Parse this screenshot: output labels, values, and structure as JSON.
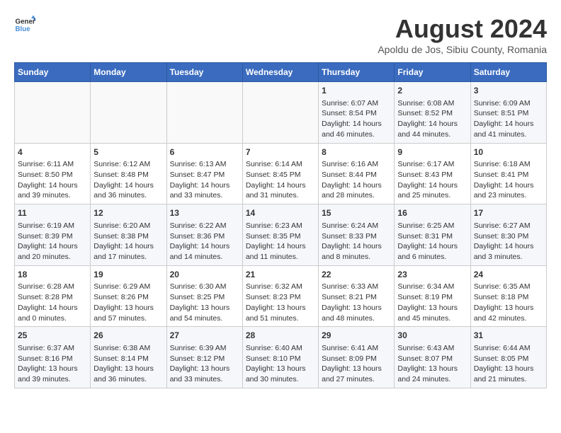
{
  "logo": {
    "line1": "General",
    "line2": "Blue"
  },
  "title": "August 2024",
  "subtitle": "Apoldu de Jos, Sibiu County, Romania",
  "weekdays": [
    "Sunday",
    "Monday",
    "Tuesday",
    "Wednesday",
    "Thursday",
    "Friday",
    "Saturday"
  ],
  "weeks": [
    [
      {
        "day": "",
        "info": ""
      },
      {
        "day": "",
        "info": ""
      },
      {
        "day": "",
        "info": ""
      },
      {
        "day": "",
        "info": ""
      },
      {
        "day": "1",
        "info": "Sunrise: 6:07 AM\nSunset: 8:54 PM\nDaylight: 14 hours and 46 minutes."
      },
      {
        "day": "2",
        "info": "Sunrise: 6:08 AM\nSunset: 8:52 PM\nDaylight: 14 hours and 44 minutes."
      },
      {
        "day": "3",
        "info": "Sunrise: 6:09 AM\nSunset: 8:51 PM\nDaylight: 14 hours and 41 minutes."
      }
    ],
    [
      {
        "day": "4",
        "info": "Sunrise: 6:11 AM\nSunset: 8:50 PM\nDaylight: 14 hours and 39 minutes."
      },
      {
        "day": "5",
        "info": "Sunrise: 6:12 AM\nSunset: 8:48 PM\nDaylight: 14 hours and 36 minutes."
      },
      {
        "day": "6",
        "info": "Sunrise: 6:13 AM\nSunset: 8:47 PM\nDaylight: 14 hours and 33 minutes."
      },
      {
        "day": "7",
        "info": "Sunrise: 6:14 AM\nSunset: 8:45 PM\nDaylight: 14 hours and 31 minutes."
      },
      {
        "day": "8",
        "info": "Sunrise: 6:16 AM\nSunset: 8:44 PM\nDaylight: 14 hours and 28 minutes."
      },
      {
        "day": "9",
        "info": "Sunrise: 6:17 AM\nSunset: 8:43 PM\nDaylight: 14 hours and 25 minutes."
      },
      {
        "day": "10",
        "info": "Sunrise: 6:18 AM\nSunset: 8:41 PM\nDaylight: 14 hours and 23 minutes."
      }
    ],
    [
      {
        "day": "11",
        "info": "Sunrise: 6:19 AM\nSunset: 8:39 PM\nDaylight: 14 hours and 20 minutes."
      },
      {
        "day": "12",
        "info": "Sunrise: 6:20 AM\nSunset: 8:38 PM\nDaylight: 14 hours and 17 minutes."
      },
      {
        "day": "13",
        "info": "Sunrise: 6:22 AM\nSunset: 8:36 PM\nDaylight: 14 hours and 14 minutes."
      },
      {
        "day": "14",
        "info": "Sunrise: 6:23 AM\nSunset: 8:35 PM\nDaylight: 14 hours and 11 minutes."
      },
      {
        "day": "15",
        "info": "Sunrise: 6:24 AM\nSunset: 8:33 PM\nDaylight: 14 hours and 8 minutes."
      },
      {
        "day": "16",
        "info": "Sunrise: 6:25 AM\nSunset: 8:31 PM\nDaylight: 14 hours and 6 minutes."
      },
      {
        "day": "17",
        "info": "Sunrise: 6:27 AM\nSunset: 8:30 PM\nDaylight: 14 hours and 3 minutes."
      }
    ],
    [
      {
        "day": "18",
        "info": "Sunrise: 6:28 AM\nSunset: 8:28 PM\nDaylight: 14 hours and 0 minutes."
      },
      {
        "day": "19",
        "info": "Sunrise: 6:29 AM\nSunset: 8:26 PM\nDaylight: 13 hours and 57 minutes."
      },
      {
        "day": "20",
        "info": "Sunrise: 6:30 AM\nSunset: 8:25 PM\nDaylight: 13 hours and 54 minutes."
      },
      {
        "day": "21",
        "info": "Sunrise: 6:32 AM\nSunset: 8:23 PM\nDaylight: 13 hours and 51 minutes."
      },
      {
        "day": "22",
        "info": "Sunrise: 6:33 AM\nSunset: 8:21 PM\nDaylight: 13 hours and 48 minutes."
      },
      {
        "day": "23",
        "info": "Sunrise: 6:34 AM\nSunset: 8:19 PM\nDaylight: 13 hours and 45 minutes."
      },
      {
        "day": "24",
        "info": "Sunrise: 6:35 AM\nSunset: 8:18 PM\nDaylight: 13 hours and 42 minutes."
      }
    ],
    [
      {
        "day": "25",
        "info": "Sunrise: 6:37 AM\nSunset: 8:16 PM\nDaylight: 13 hours and 39 minutes."
      },
      {
        "day": "26",
        "info": "Sunrise: 6:38 AM\nSunset: 8:14 PM\nDaylight: 13 hours and 36 minutes."
      },
      {
        "day": "27",
        "info": "Sunrise: 6:39 AM\nSunset: 8:12 PM\nDaylight: 13 hours and 33 minutes."
      },
      {
        "day": "28",
        "info": "Sunrise: 6:40 AM\nSunset: 8:10 PM\nDaylight: 13 hours and 30 minutes."
      },
      {
        "day": "29",
        "info": "Sunrise: 6:41 AM\nSunset: 8:09 PM\nDaylight: 13 hours and 27 minutes."
      },
      {
        "day": "30",
        "info": "Sunrise: 6:43 AM\nSunset: 8:07 PM\nDaylight: 13 hours and 24 minutes."
      },
      {
        "day": "31",
        "info": "Sunrise: 6:44 AM\nSunset: 8:05 PM\nDaylight: 13 hours and 21 minutes."
      }
    ]
  ]
}
